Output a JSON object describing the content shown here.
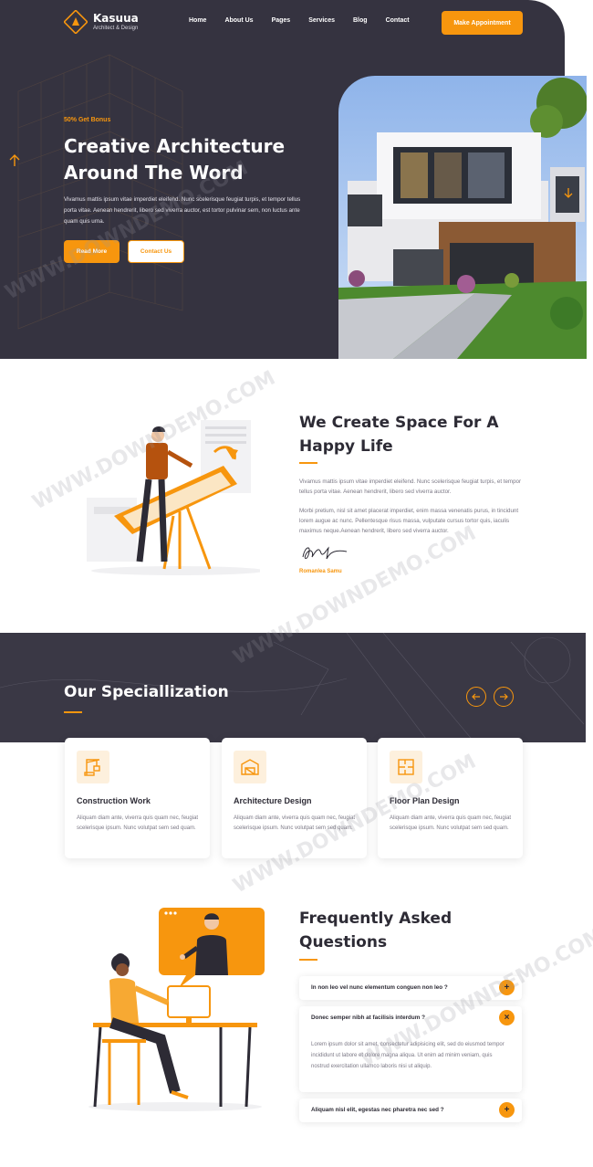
{
  "brand": {
    "name": "Kasuua",
    "tagline": "Architect & Design"
  },
  "nav": [
    "Home",
    "About Us",
    "Pages",
    "Services",
    "Blog",
    "Contact"
  ],
  "header": {
    "cta_label": "Make Appointment"
  },
  "hero": {
    "badge": "50% Get Bonus",
    "title": "Creative Architecture Around The Word",
    "text": "Vivamus mattis ipsum vitae imperdiet eleifend. Nunc scelerisque feugiat turpis, et tempor tellus porta vitae. Aenean hendrerit, libero sed viverra auctor, est tortor pulvinar sem, non luctus ante quam quis urna.",
    "primary_btn": "Read More",
    "secondary_btn": "Contact Us"
  },
  "about": {
    "title": "We Create Space For A Happy Life",
    "p1": "Vivamus mattis ipsum vitae imperdiet eleifend. Nunc scelerisque feugiat turpis, et tempor tellus porta vitae. Aenean hendrerit, libero sed viverra auctor.",
    "p2": "Morbi pretium, nisl sit amet placerat imperdiet, enim massa venenatis purus, in tincidunt lorem augue ac nunc. Pellentesque risus massa, vulputate cursus tortor quis, iaculis maximus neque.Aenean hendrerit, libero sed viverra auctor.",
    "signer": "Romanlea Samu"
  },
  "specialization": {
    "title": "Our Speciallization",
    "prev_icon": "arrow-left-icon",
    "next_icon": "arrow-right-icon",
    "cards": [
      {
        "icon": "crane-icon",
        "title": "Construction Work",
        "text": "Aliquam diam ante, viverra quis quam nec, feugiat scelerisque ipsum. Nunc volutpat sem sed quam."
      },
      {
        "icon": "blueprint-icon",
        "title": "Architecture Design",
        "text": "Aliquam diam ante, viverra quis quam nec, feugiat scelerisque ipsum. Nunc volutpat sem sed quam."
      },
      {
        "icon": "floor-plan-icon",
        "title": "Floor Plan Design",
        "text": "Aliquam diam ante, viverra quis quam nec, feugiat scelerisque ipsum. Nunc volutpat sem sed quam."
      }
    ]
  },
  "faq": {
    "title": "Frequently Asked Questions",
    "items": [
      {
        "q": "In non leo vel nunc elementum conguen non leo ?",
        "toggle": "+",
        "open": false
      },
      {
        "q": "Donec semper nibh at facilisis interdum ?",
        "toggle": "×",
        "open": true,
        "a": "Lorem ipsum dolor sit amet, consectetur adipisicing elit, sed do eiusmod tempor incididunt ut labore et dolore magna aliqua. Ut enim ad minim veniam, quis nostrud exercitation ullamco laboris nisi ut aliquip."
      },
      {
        "q": "Aliquam nisl elit, egestas nec pharetra nec sed ?",
        "toggle": "+",
        "open": false
      }
    ]
  },
  "watermark": "WWW.DOWNDEMO.COM",
  "colors": {
    "accent": "#f7960e",
    "dark": "#353340",
    "text": "#2d2b35",
    "muted": "#7b7885"
  }
}
